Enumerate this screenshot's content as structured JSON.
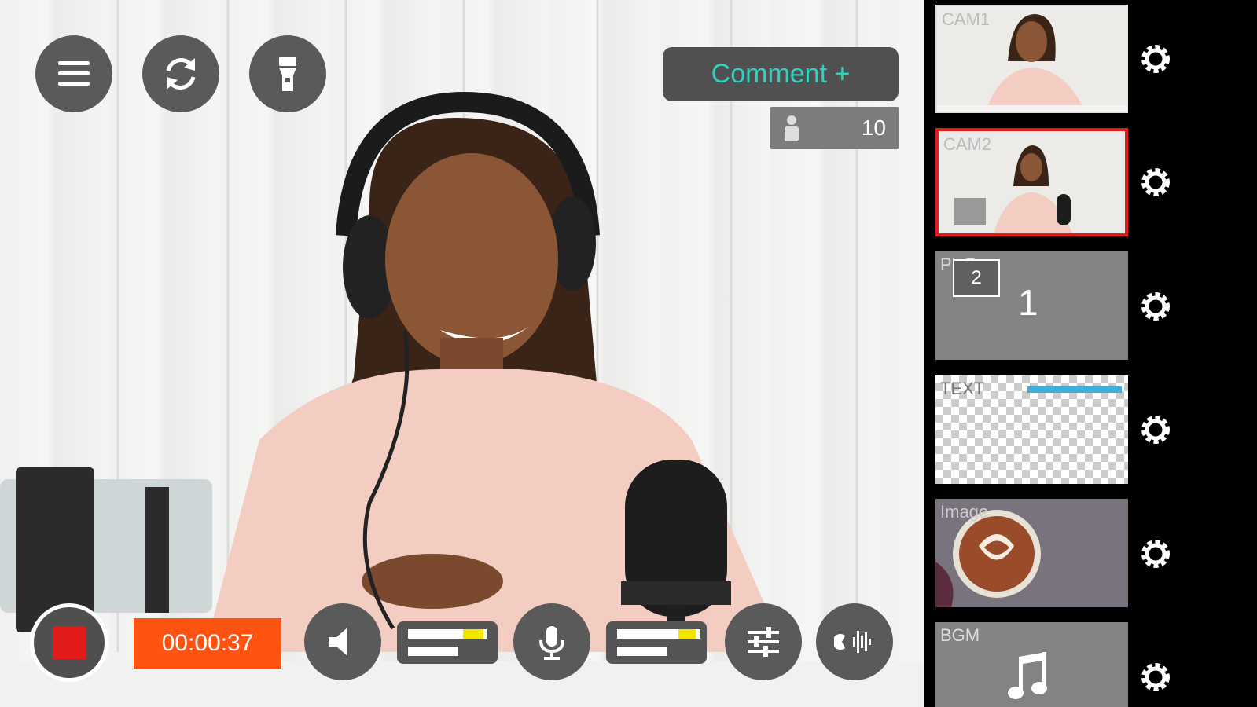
{
  "controls": {
    "menu_icon": "hamburger-menu-icon",
    "switch_camera_icon": "refresh-icon",
    "flashlight_icon": "flashlight-icon",
    "comment_label": "Comment +",
    "viewer_count": "10"
  },
  "bottom_bar": {
    "timer": "00:00:37",
    "speaker_level": 0.72,
    "mic_level": 0.78
  },
  "sources": [
    {
      "label": "CAM1",
      "type": "camera",
      "selected": false
    },
    {
      "label": "CAM2",
      "type": "camera",
      "selected": true
    },
    {
      "label": "PinP",
      "type": "pip",
      "main": "1",
      "sub": "2"
    },
    {
      "label": "TEXT",
      "type": "text"
    },
    {
      "label": "Image",
      "type": "image"
    },
    {
      "label": "BGM",
      "type": "bgm"
    }
  ],
  "colors": {
    "accent": "#2fd1c0",
    "record": "#e31b1b",
    "timer_bg": "#ff5312",
    "level_highlight": "#f3e600",
    "selected_border": "#e21c1c"
  }
}
